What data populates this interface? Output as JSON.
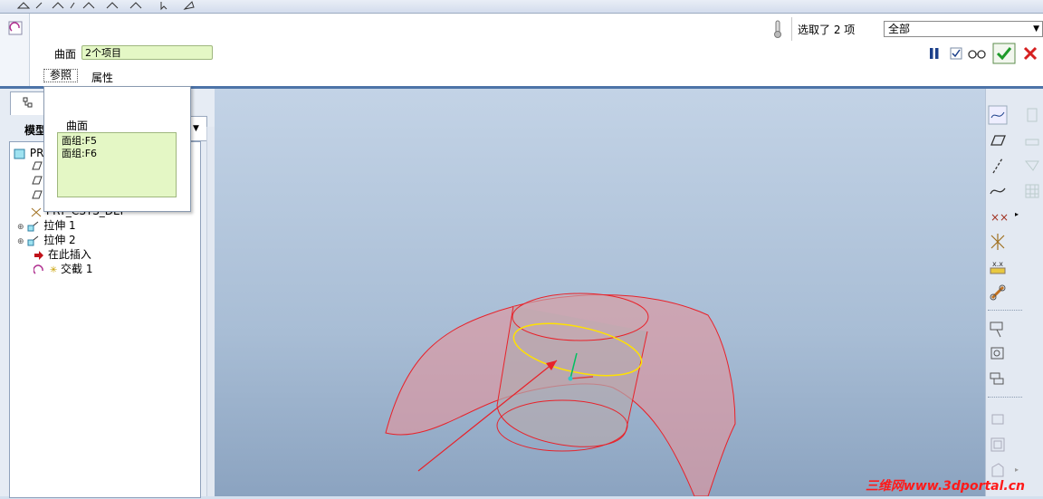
{
  "dashboard": {
    "collector_label": "曲面",
    "collector_value": "2个项目",
    "tabs": [
      {
        "label": "参照"
      },
      {
        "label": "属性"
      }
    ],
    "selection_status": "选取了 2 项",
    "filter_value": "全部"
  },
  "popup": {
    "title": "曲面",
    "items": [
      "面组:F5",
      "面组:F6"
    ]
  },
  "model_tree": {
    "tab_label": "模型",
    "rows": [
      {
        "label": "PR"
      },
      {
        "label": ""
      },
      {
        "label": ""
      },
      {
        "label": ""
      },
      {
        "label": "PRT_CSYS_DEF"
      },
      {
        "label": "拉伸 1"
      },
      {
        "label": "拉伸 2"
      },
      {
        "label": "在此插入"
      },
      {
        "label": "交截 1"
      }
    ]
  },
  "watermark": "三维网www.3dportal.cn",
  "colors": {
    "accept": "#1f9a2a",
    "cancel": "#d62020",
    "collector_bg": "#e4f7c5",
    "surface_edge": "#e8222a",
    "highlight_edge": "#ffe100"
  }
}
